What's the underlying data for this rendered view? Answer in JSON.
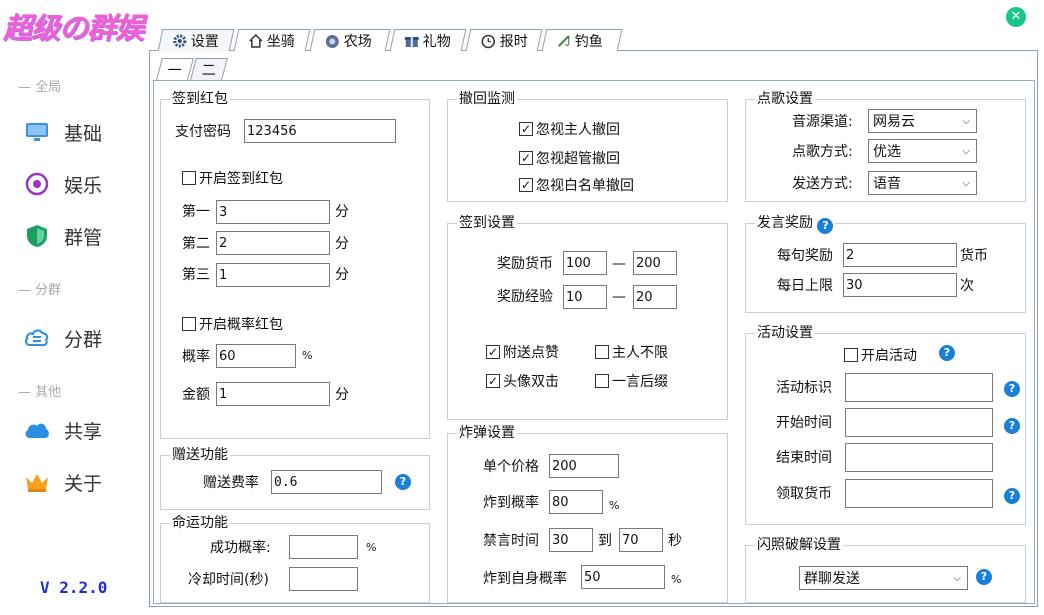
{
  "app": {
    "title": "超级の群娱",
    "close_glyph": "✕",
    "version": "V 2.2.0"
  },
  "sidebar": {
    "sections": [
      "全局",
      "分群",
      "其他"
    ],
    "items": [
      {
        "label": "基础",
        "icon": "monitor-icon"
      },
      {
        "label": "娱乐",
        "icon": "target-icon"
      },
      {
        "label": "群管",
        "icon": "shield-icon"
      },
      {
        "label": "分群",
        "icon": "cloud-menu-icon"
      },
      {
        "label": "共享",
        "icon": "cloud-icon"
      },
      {
        "label": "关于",
        "icon": "crown-icon"
      }
    ]
  },
  "tabs": [
    {
      "label": "设置",
      "icon": "gear-icon",
      "active": true
    },
    {
      "label": "坐骑",
      "icon": "house-icon"
    },
    {
      "label": "农场",
      "icon": "flower-icon"
    },
    {
      "label": "礼物",
      "icon": "gift-icon"
    },
    {
      "label": "报时",
      "icon": "clock-icon"
    },
    {
      "label": "钓鱼",
      "icon": "fishing-icon"
    }
  ],
  "subtabs": [
    "一",
    "二"
  ],
  "signin_redpack": {
    "title": "签到红包",
    "pay_pwd_label": "支付密码",
    "pay_pwd": "123456",
    "enable_label": "开启签到红包",
    "rows": [
      {
        "label": "第一",
        "value": "3",
        "unit": "分"
      },
      {
        "label": "第二",
        "value": "2",
        "unit": "分"
      },
      {
        "label": "第三",
        "value": "1",
        "unit": "分"
      }
    ],
    "prob_enable_label": "开启概率红包",
    "prob_label": "概率",
    "prob": "60",
    "prob_unit": "%",
    "amount_label": "金额",
    "amount": "1",
    "amount_unit": "分"
  },
  "gift": {
    "title": "赠送功能",
    "fee_label": "赠送费率",
    "fee": "0.6"
  },
  "fate": {
    "title": "命运功能",
    "success_label": "成功概率:",
    "success": "",
    "success_unit": "%",
    "cooldown_label": "冷却时间(秒)",
    "cooldown": ""
  },
  "recall": {
    "title": "撤回监测",
    "items": [
      "忽视主人撤回",
      "忽视超管撤回",
      "忽视白名单撤回"
    ]
  },
  "signin": {
    "title": "签到设置",
    "coin_label": "奖励货币",
    "coin_min": "100",
    "coin_max": "200",
    "exp_label": "奖励经验",
    "exp_min": "10",
    "exp_max": "20",
    "dash": "—",
    "checks": [
      {
        "label": "附送点赞",
        "checked": true
      },
      {
        "label": "主人不限",
        "checked": false
      },
      {
        "label": "头像双击",
        "checked": true
      },
      {
        "label": "一言后缀",
        "checked": false
      }
    ]
  },
  "bomb": {
    "title": "炸弹设置",
    "price_label": "单个价格",
    "price": "200",
    "hit_label": "炸到概率",
    "hit": "80",
    "hit_unit": "%",
    "mute_label": "禁言时间",
    "mute_from": "30",
    "mute_to_label": "到",
    "mute_to": "70",
    "mute_unit": "秒",
    "self_label": "炸到自身概率",
    "self": "50",
    "self_unit": "%"
  },
  "song": {
    "title": "点歌设置",
    "source_label": "音源渠道:",
    "source": "网易云",
    "mode_label": "点歌方式:",
    "mode": "优选",
    "send_label": "发送方式:",
    "send": "语音"
  },
  "speech": {
    "title": "发言奖励",
    "per_label": "每句奖励",
    "per": "2",
    "per_unit": "货币",
    "daily_label": "每日上限",
    "daily": "30",
    "daily_unit": "次"
  },
  "activity": {
    "title": "活动设置",
    "enable_label": "开启活动",
    "id_label": "活动标识",
    "start_label": "开始时间",
    "end_label": "结束时间",
    "claim_label": "领取货币"
  },
  "flash": {
    "title": "闪照破解设置",
    "mode": "群聊发送"
  },
  "colors": {
    "accent": "#1a7fd6",
    "logo": "#f060d0",
    "close": "#19c78d",
    "version": "#2030d0"
  }
}
